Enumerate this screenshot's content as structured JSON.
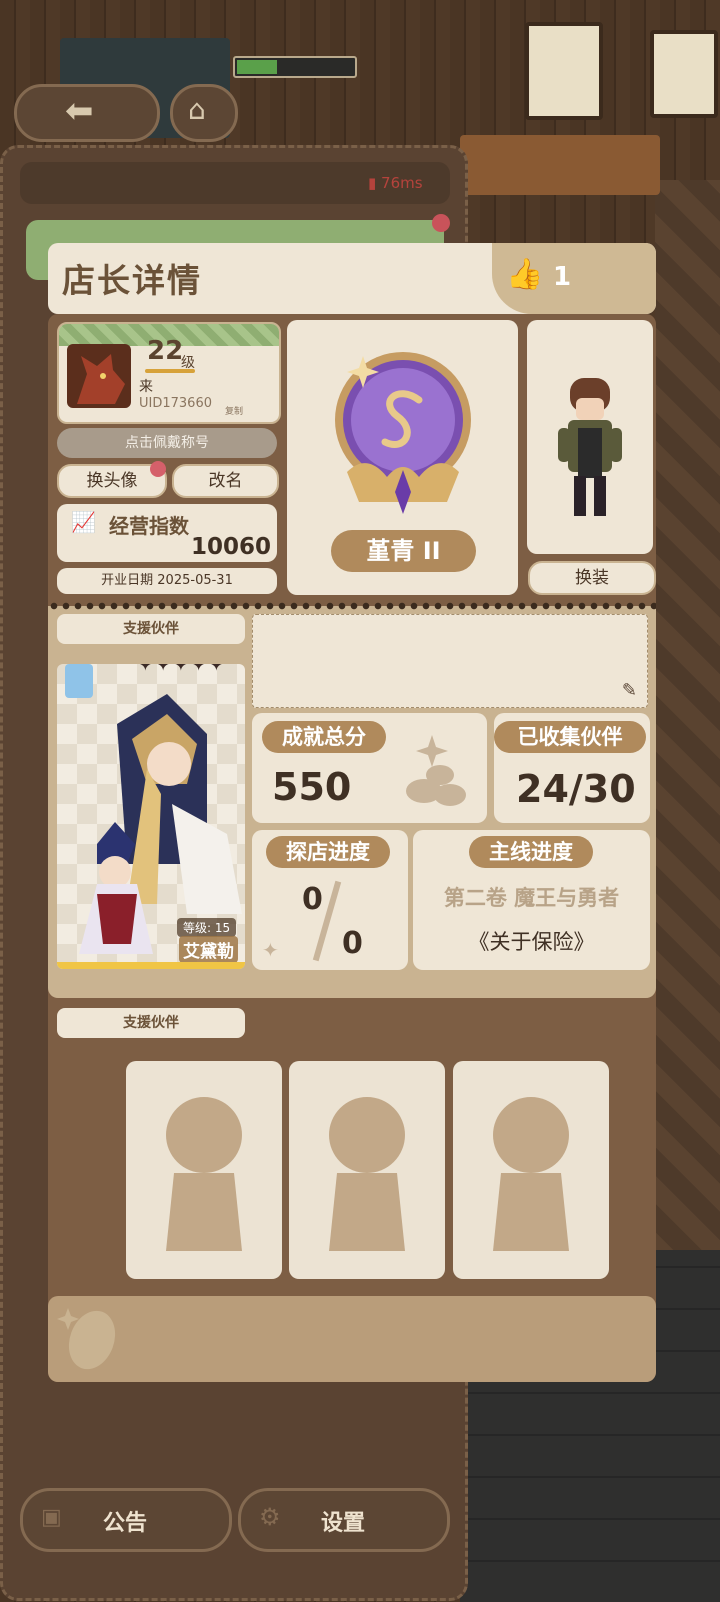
{
  "hud": {
    "ping": "76ms"
  },
  "header": {
    "title": "店长详情",
    "likes": "1"
  },
  "profile": {
    "level": "22",
    "level_suffix": "级",
    "name": "来",
    "uid": "UID173660",
    "copy_label": "复制",
    "title_button": "点击佩戴称号",
    "change_avatar": "换头像",
    "rename": "改名",
    "index_label": "经营指数",
    "index_value": "10060",
    "open_date": "开业日期 2025-05-31"
  },
  "rank": {
    "name": "堇青 II"
  },
  "outfit": {
    "button": "换装"
  },
  "support": {
    "tab_label": "支援伙伴",
    "partner_level": "等级: 15",
    "partner_name": "艾黛勒",
    "partner_stars": 5
  },
  "stats": {
    "achievement_label": "成就总分",
    "achievement_value": "550",
    "collected_label": "已收集伙伴",
    "collected_value": "24/30",
    "explore_label": "探店进度",
    "explore_current": "0",
    "explore_total": "0",
    "story_label": "主线进度",
    "story_volume": "第二卷 魔王与勇者",
    "story_chapter": "《关于保险》"
  },
  "support_lower": {
    "tab_label": "支援伙伴"
  },
  "bottom": {
    "notice": "公告",
    "settings": "设置"
  },
  "colors": {
    "accent": "#b08a5c",
    "card": "#efe6d6",
    "panel": "#7d5e44"
  }
}
